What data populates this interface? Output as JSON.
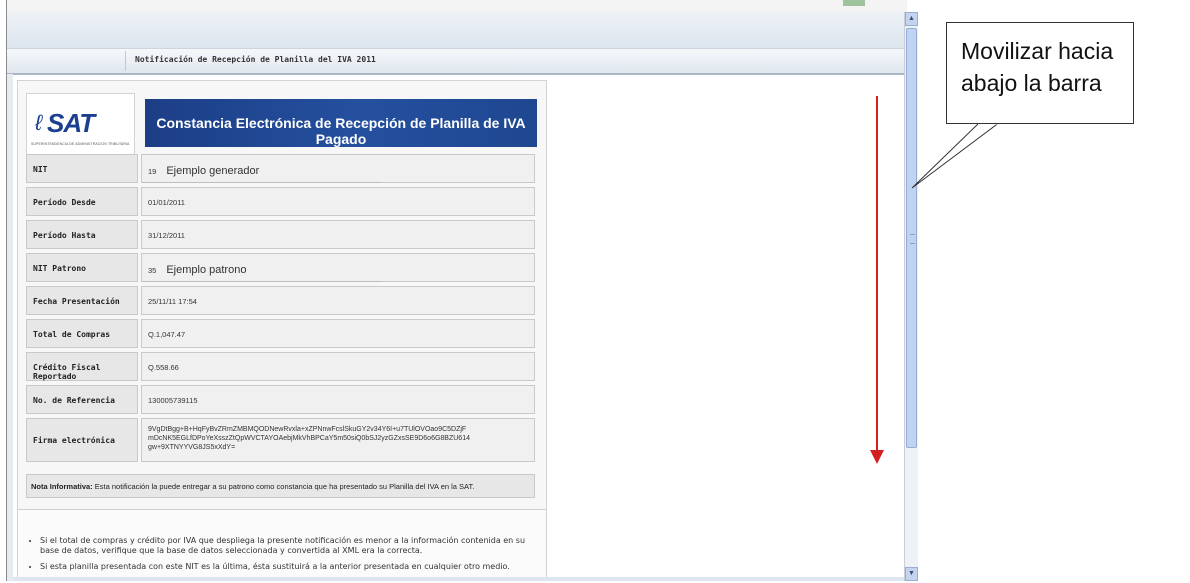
{
  "page": {
    "title": "Notificación de Recepción de Planilla del IVA 2011"
  },
  "logo": {
    "text": "SAT",
    "tagline": "SUPERINTENDENCIA DE ADMINISTRACION TRIBUTARIA"
  },
  "banner": {
    "title": "Constancia Electrónica de Recepción de Planilla de IVA Pagado"
  },
  "fields": [
    {
      "label": "NIT",
      "prefix": "19",
      "value": "Ejemplo generador"
    },
    {
      "label": "Período Desde",
      "prefix": "",
      "value": "01/01/2011"
    },
    {
      "label": "Período Hasta",
      "prefix": "",
      "value": "31/12/2011"
    },
    {
      "label": "NIT Patrono",
      "prefix": "35",
      "value": "Ejemplo patrono"
    },
    {
      "label": "Fecha Presentación",
      "prefix": "",
      "value": "25/11/11 17:54"
    },
    {
      "label": "Total de Compras",
      "prefix": "",
      "value": "Q.1,047.47"
    },
    {
      "label": "Crédito Fiscal Reportado",
      "prefix": "",
      "value": "Q.558.66"
    },
    {
      "label": "No. de Referencia",
      "prefix": "",
      "value": "130005739115"
    }
  ],
  "firma": {
    "label": "Firma electrónica",
    "value": "9VgDtBgg+B+HqFyBvZRmZMBMQODNewRvxla+xZPNnwFcslSkuGY2v34Y6I+u7TUlOVOao9C5DZjF mDcNK5EGLfDPoYeXsszZtQpWVCTAYOAebjMkVhBPCaY5m50siQ0bSJ2yzGZxsSE9D6o6G8BZU614 gw+9XTNYYVG8JS5xXdY="
  },
  "nota": {
    "bold": "Nota Informativa:",
    "text": " Esta notificación la puede entregar a su patrono como constancia que ha presentado su Planilla del IVA en la SAT."
  },
  "bullets": [
    "Si el total de compras y crédito por IVA que despliega la presente notificación es menor a la información contenida en su base de datos, verifique que la base de datos seleccionada y convertida al XML era la correcta.",
    "Si esta planilla presentada con este NIT es la última, ésta sustituirá a la anterior presentada en cualquier otro medio."
  ],
  "callout": {
    "line1": "Movilizar hacia",
    "line2": "abajo la barra"
  },
  "colors": {
    "banner": "#1f4791",
    "arrow": "#d31f1f",
    "scroll_thumb": "#c1d3f3"
  }
}
